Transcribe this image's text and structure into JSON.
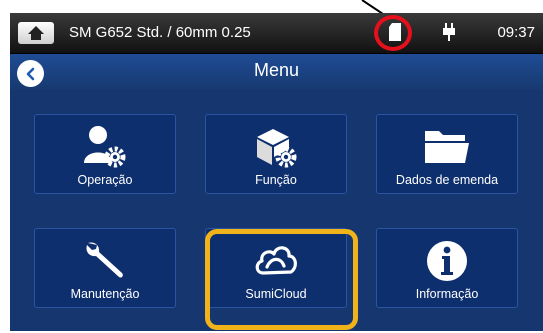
{
  "status_bar": {
    "home_icon": "home-icon",
    "program_title": "SM G652 Std. / 60mm 0.25",
    "storage_icon": "sd-card-icon",
    "power_icon": "power-plug-icon",
    "clock": "09:37"
  },
  "header": {
    "back_icon": "chevron-left-icon",
    "title": "Menu"
  },
  "tiles": [
    {
      "label": "Operação",
      "icon": "user-gear-icon"
    },
    {
      "label": "Função",
      "icon": "cube-gear-icon"
    },
    {
      "label": "Dados de emenda",
      "icon": "folder-icon"
    },
    {
      "label": "Manutenção",
      "icon": "wrench-icon"
    },
    {
      "label": "SumiCloud",
      "icon": "cloud-icon"
    },
    {
      "label": "Informação",
      "icon": "info-icon"
    }
  ],
  "colors": {
    "background": "#15366f",
    "tile": "#0e2f6e",
    "highlight": "#f0b31a",
    "annotation_circle": "#e6101c"
  }
}
